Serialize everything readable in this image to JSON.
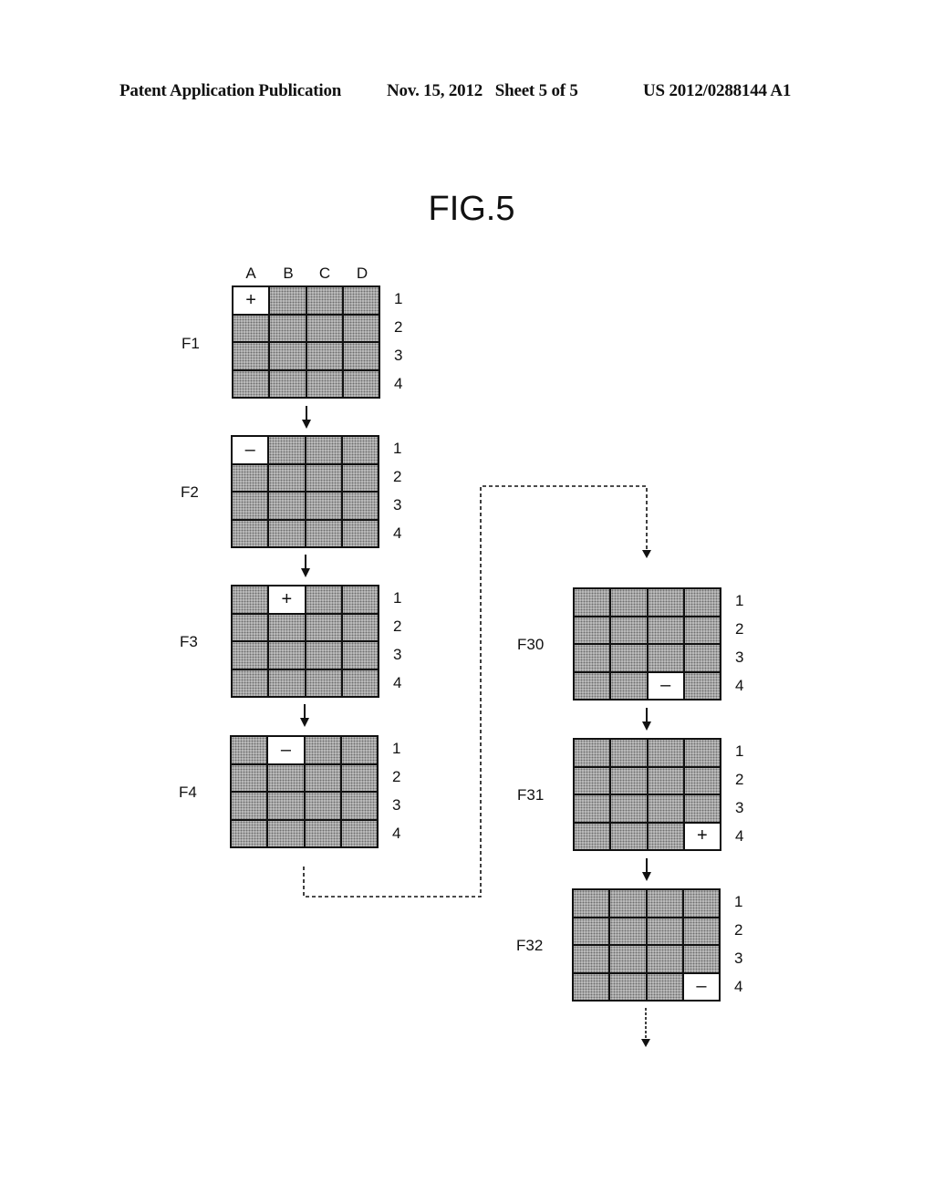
{
  "header": {
    "publication": "Patent Application Publication",
    "date_sheet": "Nov. 15, 2012   Sheet 5 of 5",
    "patent_number": "US 2012/0288144 A1"
  },
  "figure": {
    "title": "FIG.5",
    "column_labels": [
      "A",
      "B",
      "C",
      "D"
    ],
    "row_labels": [
      "1",
      "2",
      "3",
      "4"
    ],
    "frames": [
      {
        "label": "F1",
        "active_cell": "A1",
        "symbol": "+"
      },
      {
        "label": "F2",
        "active_cell": "A1",
        "symbol": "–"
      },
      {
        "label": "F3",
        "active_cell": "B1",
        "symbol": "+"
      },
      {
        "label": "F4",
        "active_cell": "B1",
        "symbol": "–"
      },
      {
        "label": "F30",
        "active_cell": "C4",
        "symbol": "–"
      },
      {
        "label": "F31",
        "active_cell": "D4",
        "symbol": "+"
      },
      {
        "label": "F32",
        "active_cell": "D4",
        "symbol": "–"
      }
    ],
    "connectors": [
      {
        "from": "F1",
        "to": "F2",
        "style": "solid"
      },
      {
        "from": "F2",
        "to": "F3",
        "style": "solid"
      },
      {
        "from": "F3",
        "to": "F4",
        "style": "solid"
      },
      {
        "from": "F4",
        "to": "F30",
        "style": "dashed"
      },
      {
        "from": "F30",
        "to": "F31",
        "style": "solid"
      },
      {
        "from": "F31",
        "to": "F32",
        "style": "solid"
      },
      {
        "from": "F32",
        "to": "continues",
        "style": "dashed"
      }
    ]
  }
}
